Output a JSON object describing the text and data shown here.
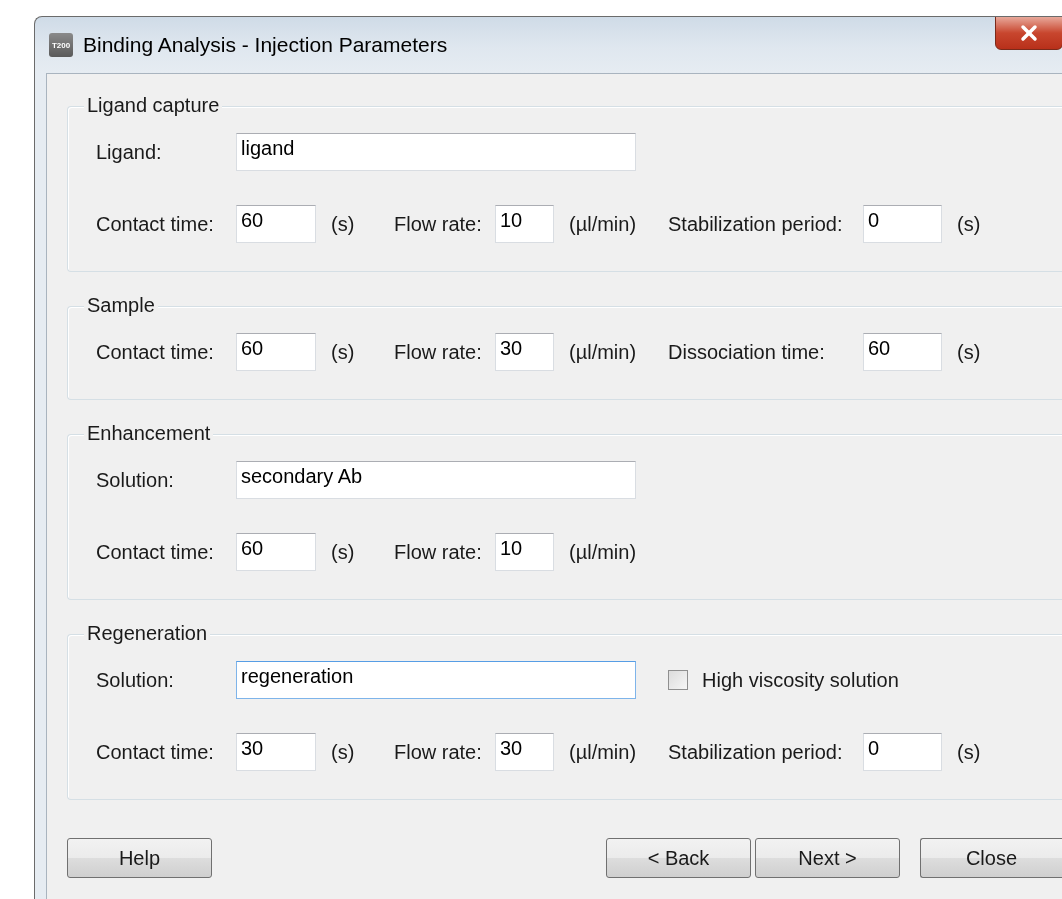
{
  "window": {
    "title": "Binding Analysis - Injection Parameters",
    "app_icon": "T200"
  },
  "sections": [
    {
      "title": "Ligand capture",
      "rows": [
        [
          {
            "kind": "label",
            "text": "Ligand:"
          },
          {
            "kind": "wide_field",
            "value": "ligand",
            "focused": false
          }
        ],
        [
          {
            "kind": "label",
            "text": "Contact time:"
          },
          {
            "kind": "field",
            "value": "60"
          },
          {
            "kind": "unit",
            "text": "(s)"
          },
          {
            "kind": "label",
            "text": "Flow rate:"
          },
          {
            "kind": "field",
            "value": "10"
          },
          {
            "kind": "unit",
            "text": "(µl/min)"
          },
          {
            "kind": "label",
            "text": "Stabilization period:"
          },
          {
            "kind": "field",
            "value": "0"
          },
          {
            "kind": "unit",
            "text": "(s)"
          }
        ]
      ]
    },
    {
      "title": "Sample",
      "rows": [
        [
          {
            "kind": "label",
            "text": "Contact time:"
          },
          {
            "kind": "field",
            "value": "60"
          },
          {
            "kind": "unit",
            "text": "(s)"
          },
          {
            "kind": "label",
            "text": "Flow rate:"
          },
          {
            "kind": "field",
            "value": "30"
          },
          {
            "kind": "unit",
            "text": "(µl/min)"
          },
          {
            "kind": "label",
            "text": "Dissociation time:"
          },
          {
            "kind": "field",
            "value": "60"
          },
          {
            "kind": "unit",
            "text": "(s)"
          }
        ]
      ]
    },
    {
      "title": "Enhancement",
      "rows": [
        [
          {
            "kind": "label",
            "text": "Solution:"
          },
          {
            "kind": "wide_field",
            "value": "secondary Ab",
            "focused": false
          }
        ],
        [
          {
            "kind": "label",
            "text": "Contact time:"
          },
          {
            "kind": "field",
            "value": "60"
          },
          {
            "kind": "unit",
            "text": "(s)"
          },
          {
            "kind": "label",
            "text": "Flow rate:"
          },
          {
            "kind": "field",
            "value": "10"
          },
          {
            "kind": "unit",
            "text": "(µl/min)"
          }
        ]
      ]
    },
    {
      "title": "Regeneration",
      "option": {
        "text": "High viscosity solution",
        "checked": false
      },
      "rows": [
        [
          {
            "kind": "label",
            "text": "Solution:"
          },
          {
            "kind": "wide_field",
            "value": "regeneration",
            "focused": true
          }
        ],
        [
          {
            "kind": "label",
            "text": "Contact time:"
          },
          {
            "kind": "field",
            "value": "30"
          },
          {
            "kind": "unit",
            "text": "(s)"
          },
          {
            "kind": "label",
            "text": "Flow rate:"
          },
          {
            "kind": "field",
            "value": "30"
          },
          {
            "kind": "unit",
            "text": "(µl/min)"
          },
          {
            "kind": "label",
            "text": "Stabilization period:"
          },
          {
            "kind": "field",
            "value": "0"
          },
          {
            "kind": "unit",
            "text": "(s)"
          }
        ]
      ]
    }
  ],
  "buttons": {
    "left": [
      "Help"
    ],
    "right": [
      "< Back",
      "Next >",
      "Close"
    ]
  }
}
